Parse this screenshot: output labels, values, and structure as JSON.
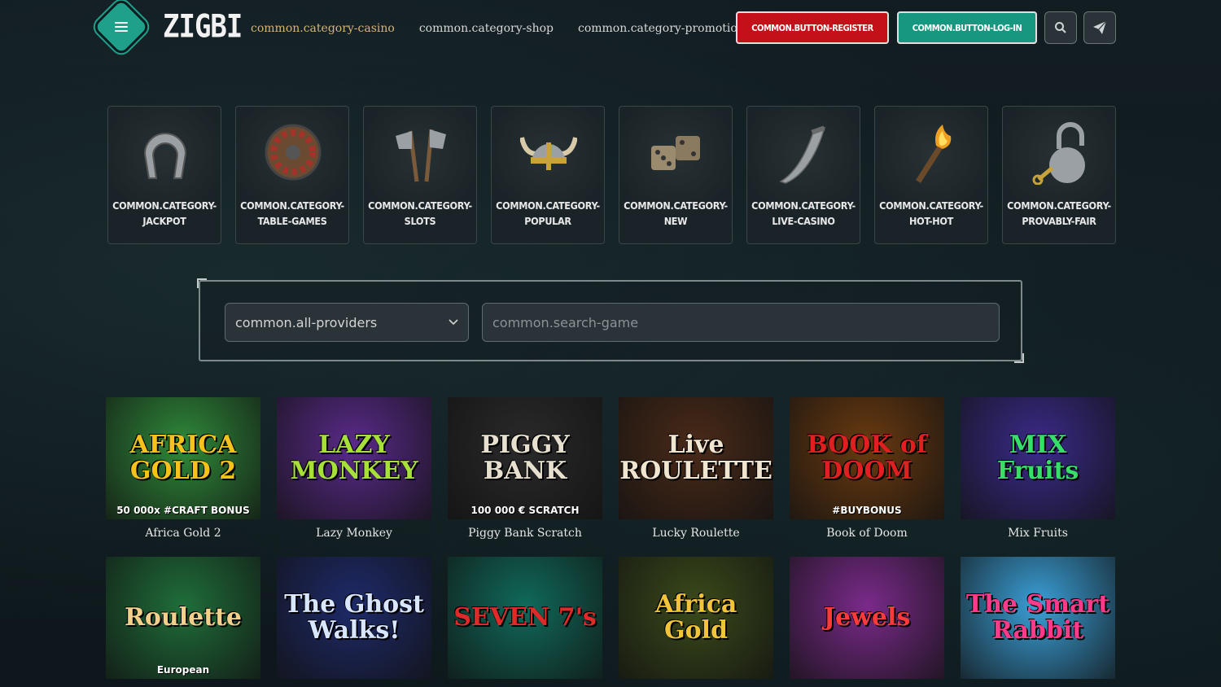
{
  "header": {
    "logo": "ZIGBI",
    "nav": [
      "common.category-casino",
      "common.category-shop",
      "common.category-promotions"
    ],
    "register_label": "COMMON.BUTTON-REGISTER",
    "login_label": "COMMON.BUTTON-LOG-IN"
  },
  "categories": [
    {
      "label": "COMMON.CATEGORY-JACKPOT",
      "icon": "horseshoe-icon"
    },
    {
      "label": "COMMON.CATEGORY-TABLE-GAMES",
      "icon": "shield-icon"
    },
    {
      "label": "COMMON.CATEGORY-SLOTS",
      "icon": "axes-icon"
    },
    {
      "label": "COMMON.CATEGORY-POPULAR",
      "icon": "viking-helmet-icon"
    },
    {
      "label": "COMMON.CATEGORY-NEW",
      "icon": "dice-icon"
    },
    {
      "label": "COMMON.CATEGORY-LIVE-CASINO",
      "icon": "horn-icon"
    },
    {
      "label": "COMMON.CATEGORY-HOT-HOT",
      "icon": "torch-icon"
    },
    {
      "label": "COMMON.CATEGORY-PROVABLY-FAIR",
      "icon": "padlock-icon"
    }
  ],
  "filter": {
    "provider_value": "common.all-providers",
    "search_placeholder": "common.search-game"
  },
  "games": [
    {
      "name": "Africa Gold 2",
      "art_title": "AFRICA GOLD 2",
      "art_sub": "50 000x  #CRAFT BONUS",
      "bg": "#2f8a3a",
      "fg": "#f5c21b"
    },
    {
      "name": "Lazy Monkey",
      "art_title": "LAZY MONKEY",
      "art_sub": "",
      "bg": "#5a2a8a",
      "fg": "#a8e03a"
    },
    {
      "name": "Piggy Bank Scratch",
      "art_title": "PIGGY BANK",
      "art_sub": "100 000 € SCRATCH",
      "bg": "#2a2a2a",
      "fg": "#e8e0cf"
    },
    {
      "name": "Lucky Roulette",
      "art_title": "Live ROULETTE",
      "art_sub": "",
      "bg": "#4a2a18",
      "fg": "#f0e6d0"
    },
    {
      "name": "Book of Doom",
      "art_title": "BOOK of DOOM",
      "art_sub": "#BUYBONUS",
      "bg": "#6a3a10",
      "fg": "#e02020"
    },
    {
      "name": "Mix Fruits",
      "art_title": "MIX Fruits",
      "art_sub": "",
      "bg": "#3b2a8a",
      "fg": "#34e06a"
    },
    {
      "name": "",
      "art_title": "Roulette",
      "art_sub": "European",
      "bg": "#1f6e3a",
      "fg": "#f0d08a"
    },
    {
      "name": "",
      "art_title": "The Ghost Walks!",
      "art_sub": "",
      "bg": "#1e2a6a",
      "fg": "#d8e6ff"
    },
    {
      "name": "",
      "art_title": "SEVEN 7's",
      "art_sub": "",
      "bg": "#0f6a5a",
      "fg": "#e02a2a"
    },
    {
      "name": "",
      "art_title": "Africa Gold",
      "art_sub": "",
      "bg": "#3a4a1a",
      "fg": "#f2c43a"
    },
    {
      "name": "",
      "art_title": "Jewels",
      "art_sub": "",
      "bg": "#7a2a8a",
      "fg": "#ff3a3a"
    },
    {
      "name": "",
      "art_title": "The Smart Rabbit",
      "art_sub": "",
      "bg": "#3aa0d8",
      "fg": "#ff3a8a"
    }
  ],
  "colors": {
    "accent_teal": "#17977f",
    "register_red": "#c41019",
    "active_nav": "#d6b479"
  }
}
